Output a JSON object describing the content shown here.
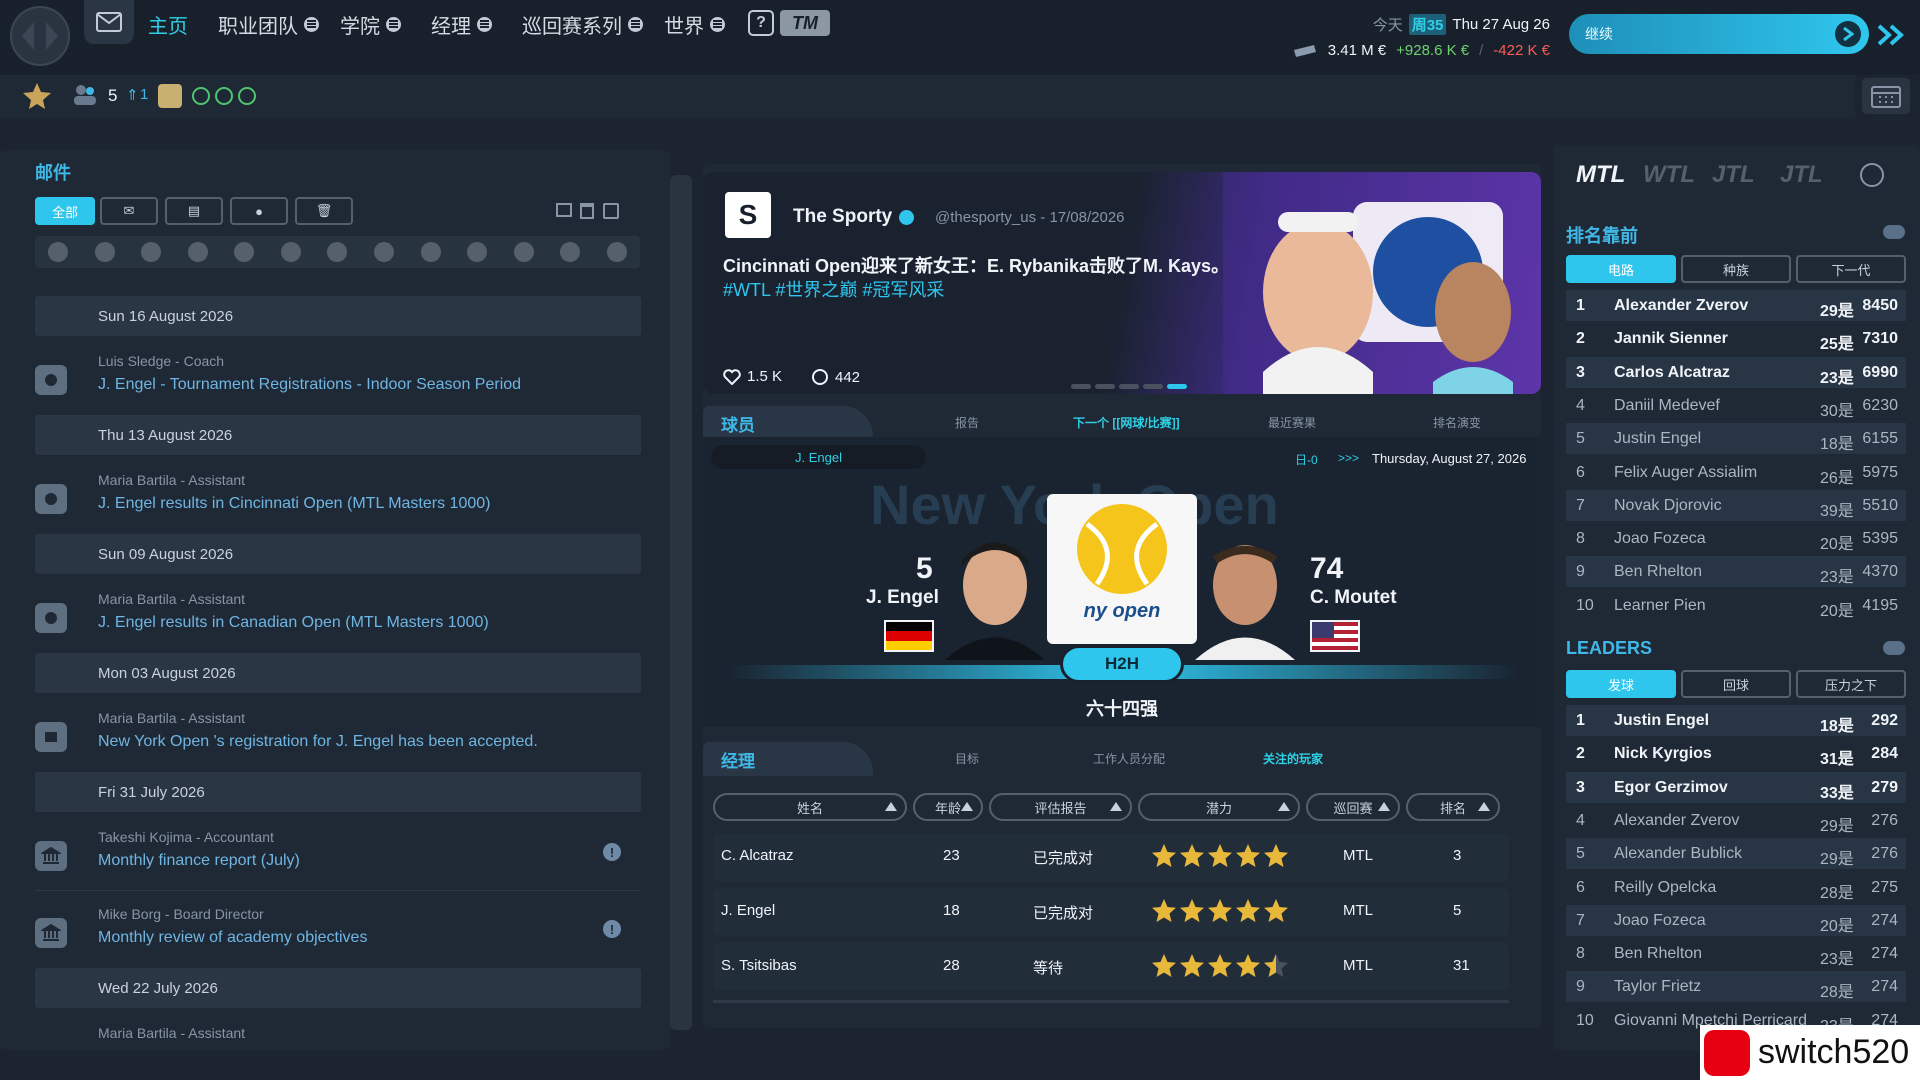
{
  "nav": {
    "items": [
      {
        "label": "主页",
        "active": true
      },
      {
        "label": "职业团队"
      },
      {
        "label": "学院"
      },
      {
        "label": "经理"
      },
      {
        "label": "巡回赛系列"
      },
      {
        "label": "世界"
      }
    ],
    "help": "?",
    "tm": "TM"
  },
  "status": {
    "today_label": "今天",
    "week": "周35",
    "date": "Thu 27 Aug 26",
    "balance": "3.41 M €",
    "income": "+928.6 K €",
    "separator": "/",
    "expense": "-422 K €",
    "continue_label": "继续"
  },
  "bar2": {
    "staff_count": "5",
    "up_count": "1"
  },
  "mail": {
    "title": "邮件",
    "filters": [
      "全部"
    ],
    "groups": [
      {
        "date": "Sun 16 August 2026",
        "items": [
          {
            "from": "Luis Sledge - Coach",
            "subject": "J. Engel - Tournament Registrations - Indoor Season Period"
          }
        ]
      },
      {
        "date": "Thu 13 August 2026",
        "items": [
          {
            "from": "Maria Bartila - Assistant",
            "subject": "J. Engel results in Cincinnati Open (MTL Masters 1000)"
          }
        ]
      },
      {
        "date": "Sun 09 August 2026",
        "items": [
          {
            "from": "Maria Bartila - Assistant",
            "subject": "J. Engel results in Canadian Open (MTL Masters 1000)"
          }
        ]
      },
      {
        "date": "Mon 03 August 2026",
        "items": [
          {
            "from": "Maria Bartila - Assistant",
            "subject": "New York Open 's registration for J. Engel has been accepted."
          }
        ]
      },
      {
        "date": "Fri 31 July 2026",
        "items": [
          {
            "from": "Takeshi Kojima - Accountant",
            "subject": "Monthly finance report (July)"
          },
          {
            "from": "Mike Borg - Board Director",
            "subject": "Monthly review of academy objectives"
          }
        ]
      },
      {
        "date": "Wed 22 July 2026",
        "items": [
          {
            "from": "Maria Bartila - Assistant",
            "subject": ""
          }
        ]
      }
    ]
  },
  "news": {
    "outlet": "The Sporty",
    "outlet_tag": "The Sporty",
    "logo_letter": "S",
    "handle": "@thesporty_us - 17/08/2026",
    "headline": "Cincinnati Open迎来了新女王：E. Rybanika击败了M. Kays。",
    "tags": "#WTL #世界之巅 #冠军风采",
    "likes": "1.5 K",
    "comments": "442"
  },
  "players": {
    "title": "球员",
    "tabs": [
      "报告",
      "下一个 [[网球/比赛]]",
      "最近赛果",
      "排名演变"
    ],
    "selected_player": "J. Engel",
    "h2h_record": "日-0",
    "arrows": ">>>",
    "match_date": "Thursday, August 27, 2026",
    "bg_title": "New York Open",
    "tourney_logo_text": "ny open",
    "h2h_label": "H2H",
    "round": "六十四强",
    "p1": {
      "rank": "5",
      "name": "J. Engel"
    },
    "p2": {
      "rank": "74",
      "name": "C. Moutet"
    }
  },
  "manager": {
    "title": "经理",
    "tabs": [
      "目标",
      "工作人员分配",
      "关注的玩家"
    ],
    "columns": [
      "姓名",
      "年龄",
      "评估报告",
      "潜力",
      "巡回赛",
      "排名"
    ],
    "rows": [
      {
        "name": "C. Alcatraz",
        "age": "23",
        "report": "已完成对",
        "stars": 5,
        "tour": "MTL",
        "rank": "3"
      },
      {
        "name": "J. Engel",
        "age": "18",
        "report": "已完成对",
        "stars": 5,
        "tour": "MTL",
        "rank": "5"
      },
      {
        "name": "S. Tsitsibas",
        "age": "28",
        "report": "等待",
        "stars": 4.5,
        "tour": "MTL",
        "rank": "31"
      }
    ]
  },
  "right": {
    "tours": [
      "MTL",
      "WTL",
      "JTL",
      "JTL"
    ],
    "rank_title": "排名靠前",
    "rank_tabs": [
      "电路",
      "种族",
      "下一代"
    ],
    "rankings": [
      {
        "rank": "1",
        "name": "Alexander Zverov",
        "age": "29是",
        "pts": "8450"
      },
      {
        "rank": "2",
        "name": "Jannik Sienner",
        "age": "25是",
        "pts": "7310"
      },
      {
        "rank": "3",
        "name": "Carlos Alcatraz",
        "age": "23是",
        "pts": "6990"
      },
      {
        "rank": "4",
        "name": "Daniil Medevef",
        "age": "30是",
        "pts": "6230"
      },
      {
        "rank": "5",
        "name": "Justin Engel",
        "age": "18是",
        "pts": "6155"
      },
      {
        "rank": "6",
        "name": "Felix Auger Assialim",
        "age": "26是",
        "pts": "5975"
      },
      {
        "rank": "7",
        "name": "Novak Djorovic",
        "age": "39是",
        "pts": "5510"
      },
      {
        "rank": "8",
        "name": "Joao Fozeca",
        "age": "20是",
        "pts": "5395"
      },
      {
        "rank": "9",
        "name": "Ben Rhelton",
        "age": "23是",
        "pts": "4370"
      },
      {
        "rank": "10",
        "name": "Learner Pien",
        "age": "20是",
        "pts": "4195"
      }
    ],
    "leaders_title": "LEADERS",
    "leader_tabs": [
      "发球",
      "回球",
      "压力之下"
    ],
    "leaders": [
      {
        "rank": "1",
        "name": "Justin Engel",
        "age": "18是",
        "pts": "292"
      },
      {
        "rank": "2",
        "name": "Nick Kyrgios",
        "age": "31是",
        "pts": "284"
      },
      {
        "rank": "3",
        "name": "Egor Gerzimov",
        "age": "33是",
        "pts": "279"
      },
      {
        "rank": "4",
        "name": "Alexander Zverov",
        "age": "29是",
        "pts": "276"
      },
      {
        "rank": "5",
        "name": "Alexander Bublick",
        "age": "29是",
        "pts": "276"
      },
      {
        "rank": "6",
        "name": "Reilly Opelcka",
        "age": "28是",
        "pts": "275"
      },
      {
        "rank": "7",
        "name": "Joao Fozeca",
        "age": "20是",
        "pts": "274"
      },
      {
        "rank": "8",
        "name": "Ben Rhelton",
        "age": "23是",
        "pts": "274"
      },
      {
        "rank": "9",
        "name": "Taylor Frietz",
        "age": "28是",
        "pts": "274"
      },
      {
        "rank": "10",
        "name": "Giovanni Mpetchi Perricard",
        "age": "23是",
        "pts": "274"
      }
    ]
  },
  "watermark": "switch520",
  "colors": {
    "accent": "#2fc6ee",
    "background": "#1b2430",
    "income": "#6fd16f",
    "expense": "#ff5a5a",
    "star": "#e8b83a"
  }
}
